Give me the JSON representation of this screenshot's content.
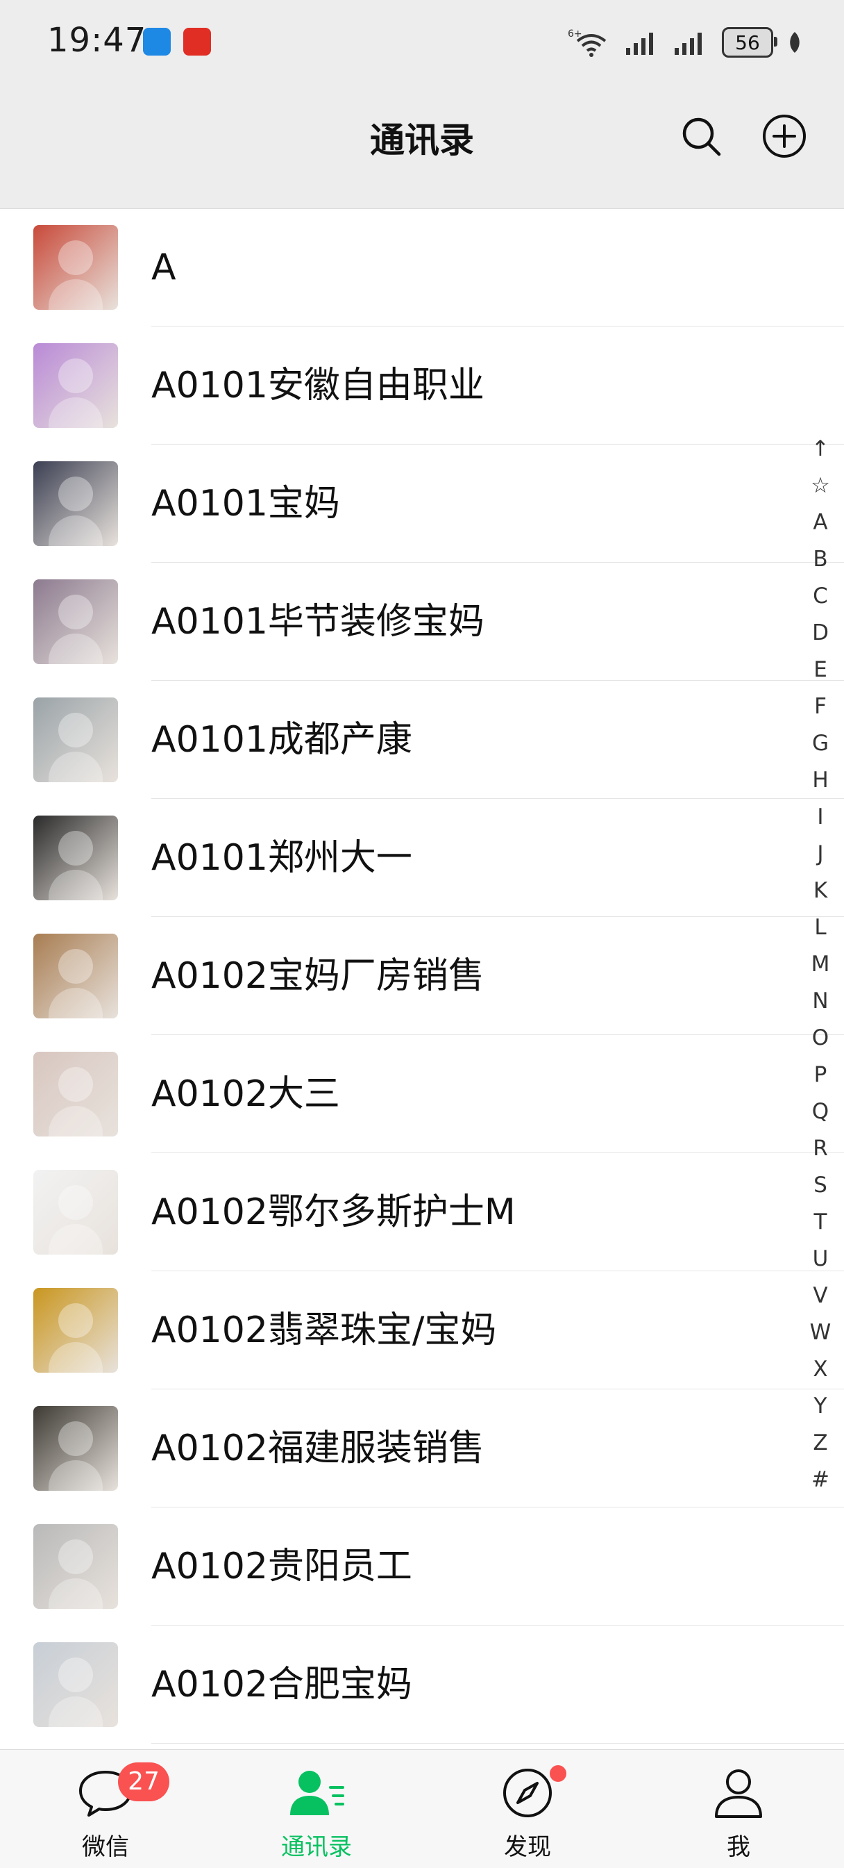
{
  "status_bar": {
    "time": "19:47",
    "network": "6+",
    "battery": "56"
  },
  "header": {
    "title": "通讯录"
  },
  "contacts": [
    {
      "name": "A",
      "avatar": "cartoon-child-avatar",
      "color": "#c84a3a"
    },
    {
      "name": "A0101安徽自由职业",
      "avatar": "cartoon-avatar",
      "color": "#b98ad6"
    },
    {
      "name": "A0101宝妈",
      "avatar": "photo-avatar",
      "color": "#3b3f52"
    },
    {
      "name": "A0101毕节装修宝妈",
      "avatar": "photo-avatar",
      "color": "#8c7a8f"
    },
    {
      "name": "A0101成都产康",
      "avatar": "photo-avatar",
      "color": "#9aa3a8"
    },
    {
      "name": "A0101郑州大一",
      "avatar": "photo-avatar",
      "color": "#2a2a2a"
    },
    {
      "name": "A0102宝妈厂房销售",
      "avatar": "photo-avatar",
      "color": "#a87d52"
    },
    {
      "name": "A0102大三",
      "avatar": "photo-avatar",
      "color": "#d8c6c0"
    },
    {
      "name": "A0102鄂尔多斯护士M",
      "avatar": "drawing-avatar",
      "color": "#f2f2f2"
    },
    {
      "name": "A0102翡翠珠宝/宝妈",
      "avatar": "photo-avatar",
      "color": "#c9961f"
    },
    {
      "name": "A0102福建服装销售",
      "avatar": "photo-avatar",
      "color": "#3d3a33"
    },
    {
      "name": "A0102贵阳员工",
      "avatar": "photo-avatar",
      "color": "#b9b9b9"
    },
    {
      "name": "A0102合肥宝妈",
      "avatar": "photo-avatar",
      "color": "#c7ced6"
    }
  ],
  "index_bar": [
    "↑",
    "☆",
    "A",
    "B",
    "C",
    "D",
    "E",
    "F",
    "G",
    "H",
    "I",
    "J",
    "K",
    "L",
    "M",
    "N",
    "O",
    "P",
    "Q",
    "R",
    "S",
    "T",
    "U",
    "V",
    "W",
    "X",
    "Y",
    "Z",
    "#"
  ],
  "tabs": [
    {
      "label": "微信",
      "icon": "chat-icon",
      "badge": "27",
      "active": false
    },
    {
      "label": "通讯录",
      "icon": "contacts-icon",
      "active": true
    },
    {
      "label": "发现",
      "icon": "compass-icon",
      "dot": true,
      "active": false
    },
    {
      "label": "我",
      "icon": "person-icon",
      "active": false
    }
  ],
  "colors": {
    "accent": "#07c160",
    "badge": "#fa5151",
    "header_bg": "#ededed",
    "tabbar_bg": "#f7f7f7"
  }
}
